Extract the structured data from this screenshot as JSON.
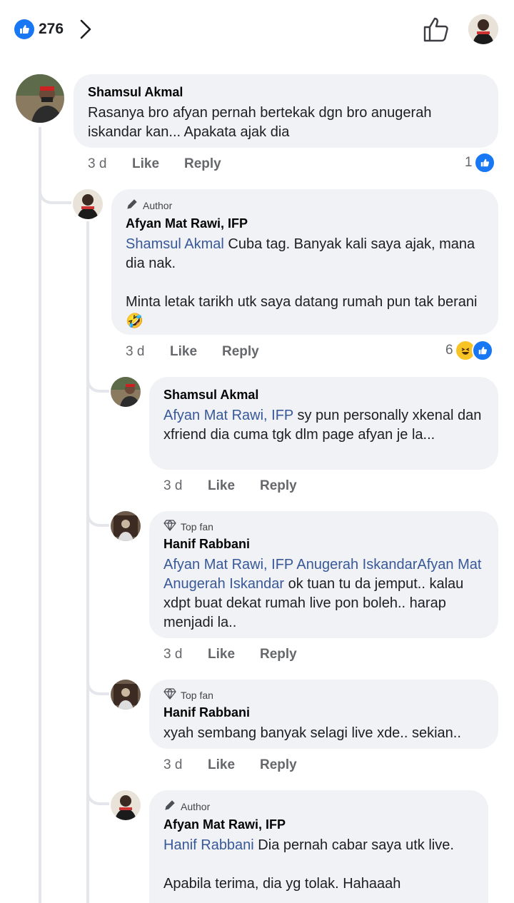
{
  "header": {
    "reaction_count": "276",
    "colors": {
      "accent": "#1877f2",
      "bubble": "#f0f2f5",
      "link": "#385898",
      "meta": "#65676b"
    }
  },
  "comments": [
    {
      "name": "Shamsul Akmal",
      "text": "Rasanya bro afyan pernah bertekak dgn bro anugerah iskandar kan... Apakata ajak dia",
      "time": "3 d",
      "like": "Like",
      "reply": "Reply",
      "reactions": "1"
    },
    {
      "badge": "Author",
      "name": "Afyan Mat Rawi, IFP",
      "tag": "Shamsul Akmal",
      "text": " Cuba tag. Banyak kali saya ajak, mana dia nak.\n\nMinta letak tarikh utk saya datang rumah pun tak berani",
      "time": "3 d",
      "like": "Like",
      "reply": "Reply",
      "reactions": "6"
    },
    {
      "name": "Shamsul Akmal",
      "tag": "Afyan Mat Rawi, IFP",
      "text": " sy pun personally xkenal dan xfriend dia cuma tgk dlm page afyan je la...",
      "time": "3 d",
      "like": "Like",
      "reply": "Reply"
    },
    {
      "badge": "Top fan",
      "name": "Hanif Rabbani",
      "tag": "Afyan Mat Rawi, IFP Anugerah IskandarAfyan Mat Anugerah Iskandar",
      "text": " ok tuan tu da jemput.. kalau xdpt buat dekat rumah live pon boleh.. harap menjadi la..",
      "time": "3 d",
      "like": "Like",
      "reply": "Reply"
    },
    {
      "badge": "Top fan",
      "name": "Hanif Rabbani",
      "text": "xyah sembang banyak selagi live xde.. sekian..",
      "time": "3 d",
      "like": "Like",
      "reply": "Reply"
    },
    {
      "badge": "Author",
      "name": "Afyan Mat Rawi, IFP",
      "tag": "Hanif Rabbani",
      "text": " Dia pernah cabar saya utk live.\n\nApabila terima, dia yg tolak. Hahaaah"
    }
  ]
}
